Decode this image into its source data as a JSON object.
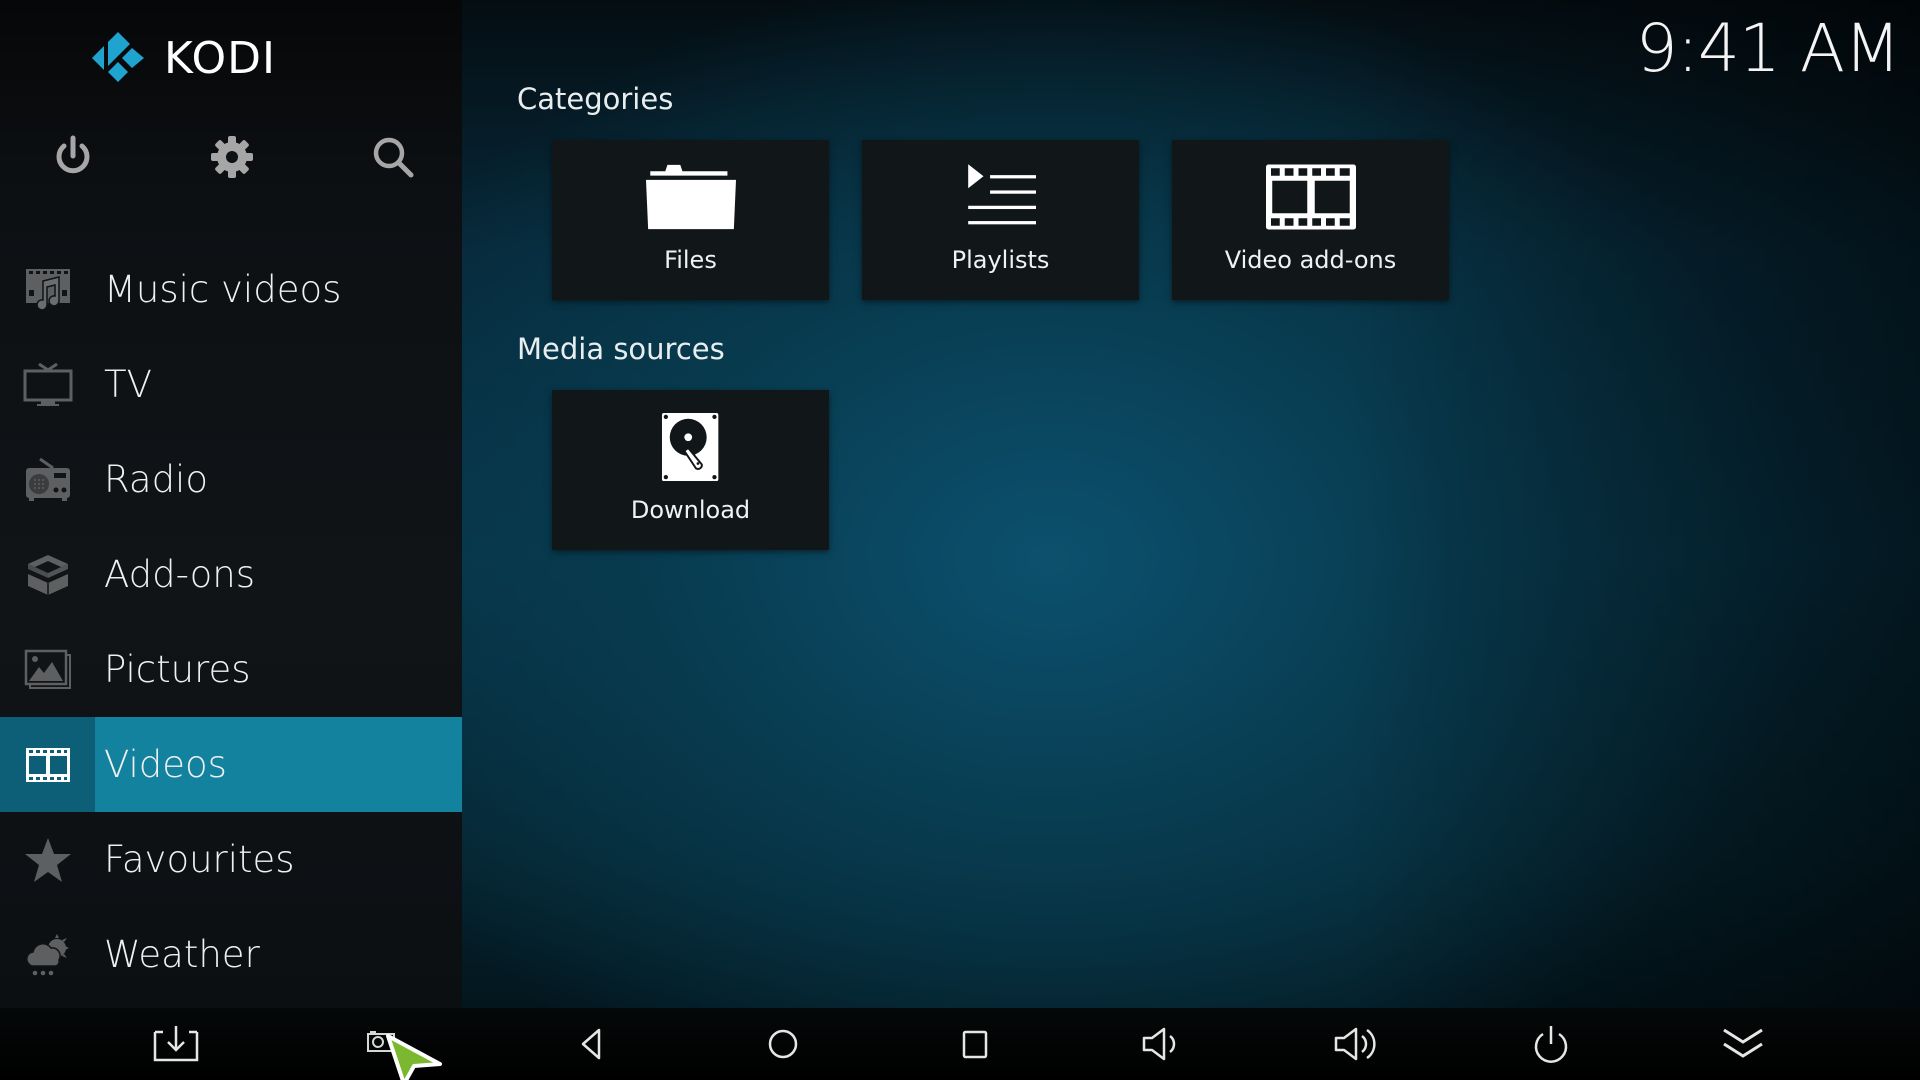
{
  "app": {
    "name": "KODI",
    "brand_color": "#1fa3cf",
    "accent_color": "#12829f"
  },
  "clock": {
    "time": "9:41 AM"
  },
  "top_icons": [
    {
      "name": "power-icon",
      "label": "Power"
    },
    {
      "name": "gear-icon",
      "label": "Settings"
    },
    {
      "name": "search-icon",
      "label": "Search"
    }
  ],
  "sidebar": {
    "items": [
      {
        "label": "Music videos",
        "icon": "music-video-icon",
        "active": false
      },
      {
        "label": "TV",
        "icon": "tv-icon",
        "active": false
      },
      {
        "label": "Radio",
        "icon": "radio-icon",
        "active": false
      },
      {
        "label": "Add-ons",
        "icon": "addons-box-icon",
        "active": false
      },
      {
        "label": "Pictures",
        "icon": "pictures-icon",
        "active": false
      },
      {
        "label": "Videos",
        "icon": "film-icon",
        "active": true
      },
      {
        "label": "Favourites",
        "icon": "star-icon",
        "active": false
      },
      {
        "label": "Weather",
        "icon": "weather-icon",
        "active": false
      }
    ]
  },
  "main": {
    "categories": {
      "title": "Categories",
      "tiles": [
        {
          "label": "Files",
          "icon": "folder-icon"
        },
        {
          "label": "Playlists",
          "icon": "playlist-icon"
        },
        {
          "label": "Video add-ons",
          "icon": "film-icon"
        }
      ]
    },
    "media_sources": {
      "title": "Media sources",
      "tiles": [
        {
          "label": "Download",
          "icon": "hard-drive-icon"
        }
      ]
    }
  },
  "bottom_bar": {
    "buttons": [
      {
        "name": "download-icon"
      },
      {
        "name": "screenshot-icon"
      },
      {
        "name": "back-triangle-icon"
      },
      {
        "name": "home-circle-icon"
      },
      {
        "name": "recents-square-icon"
      },
      {
        "name": "volume-down-icon"
      },
      {
        "name": "volume-up-icon"
      },
      {
        "name": "power-icon"
      },
      {
        "name": "collapse-chevrons-icon"
      }
    ]
  }
}
